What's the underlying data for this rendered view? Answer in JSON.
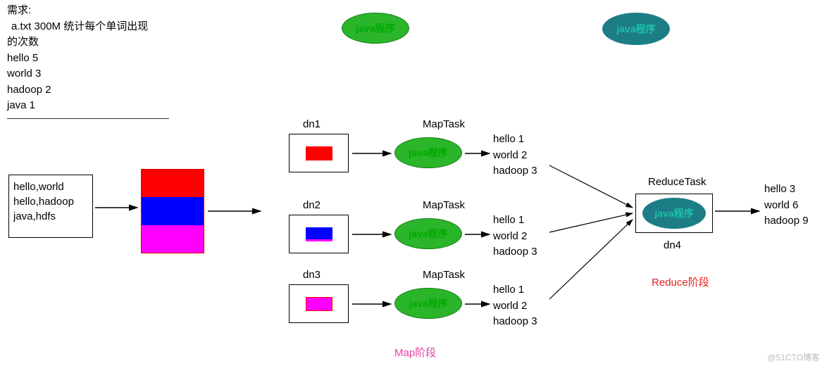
{
  "requirement": {
    "title": "需求:",
    "line1": "a.txt  300M   统计每个单词出现",
    "line2": "的次数",
    "rows": [
      "hello 5",
      "world 3",
      "hadoop 2",
      "java  1"
    ]
  },
  "input_box": [
    "hello,world",
    "hello,hadoop",
    "java,hdfs"
  ],
  "top_ellipse_green": "java程序",
  "top_ellipse_teal": "java程序",
  "datanodes": [
    {
      "name": "dn1",
      "task": "MapTask",
      "java": "java程序",
      "kv": [
        "hello  1",
        "world  2",
        "hadoop 3"
      ]
    },
    {
      "name": "dn2",
      "task": "MapTask",
      "java": "java程序",
      "kv": [
        "hello  1",
        "world  2",
        "hadoop 3"
      ]
    },
    {
      "name": "dn3",
      "task": "MapTask",
      "java": "java程序",
      "kv": [
        "hello  1",
        "world  2",
        "hadoop 3"
      ]
    }
  ],
  "map_phase_label": "Map阶段",
  "reduce": {
    "task": "ReduceTask",
    "java": "java程序",
    "dn": "dn4",
    "phase_label": "Reduce阶段",
    "output": [
      "hello 3",
      "world 6",
      "hadoop 9"
    ]
  },
  "watermark": "@51CTO博客"
}
